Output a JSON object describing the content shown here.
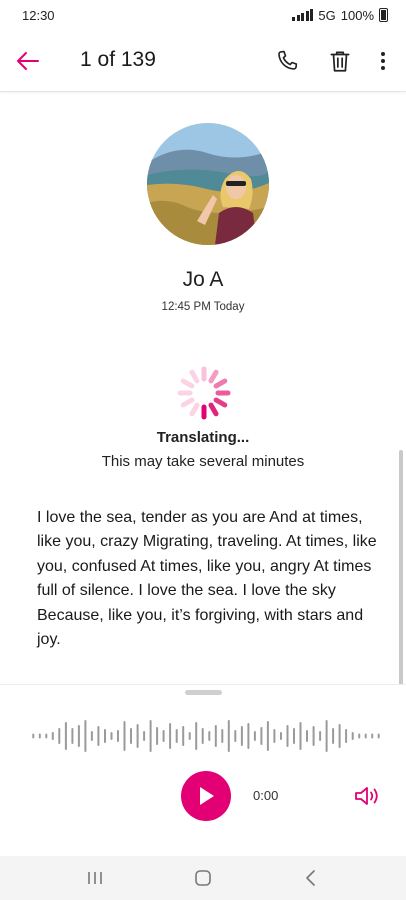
{
  "status_bar": {
    "time": "12:30",
    "network": "5G",
    "battery": "100%"
  },
  "header": {
    "title": "1 of 139"
  },
  "contact": {
    "name": "Jo A",
    "time": "12:45 PM Today"
  },
  "translation": {
    "title": "Translating...",
    "subtitle": "This may take several minutes"
  },
  "transcript": {
    "text": "I love the sea, tender as you are And at times, like you, crazy Migrating, traveling. At times, like you, confused At times, like you,  angry At times full of silence. I love the sea. I love the sky Because, like you, it’s forgiving, with stars and joy."
  },
  "player": {
    "time": "0:00"
  },
  "colors": {
    "accent": "#e20074"
  },
  "icons": {
    "back": "arrow-left-icon",
    "call": "phone-icon",
    "delete": "trash-icon",
    "more": "more-vertical-icon",
    "play": "play-icon",
    "speaker": "speaker-icon",
    "spinner": "loading-spinner-icon",
    "nav_recents": "recents-icon",
    "nav_home": "home-icon",
    "nav_back": "chevron-left-icon"
  }
}
